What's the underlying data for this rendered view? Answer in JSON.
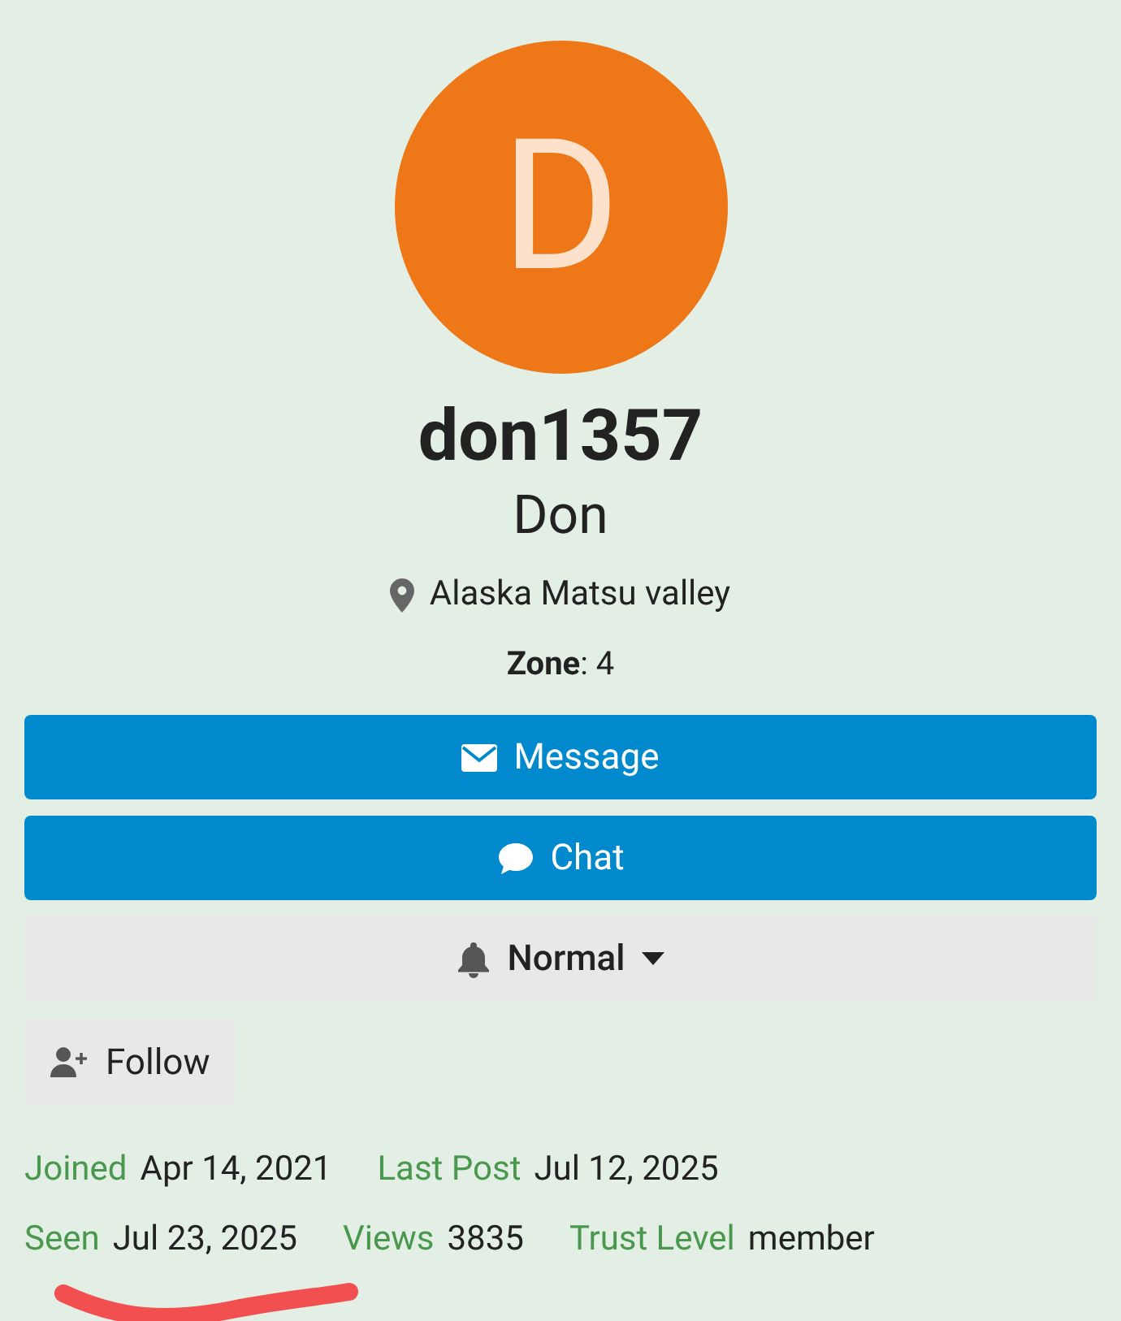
{
  "profile": {
    "avatar_letter": "D",
    "username": "don1357",
    "name": "Don",
    "location": "Alaska Matsu valley",
    "zone": "**Zone**: 4"
  },
  "actions": [
    {
      "kind": "primary",
      "label": "Message"
    },
    {
      "kind": "primary",
      "label": "Chat"
    },
    {
      "kind": "dropdown",
      "label": "Normal"
    }
  ],
  "follow": {
    "label": "Follow"
  },
  "stats": [
    [
      {
        "label": "Joined",
        "value": "Apr 14, 2021"
      },
      {
        "label": "Last Post",
        "value": "Jul 12, 2025"
      }
    ],
    [
      {
        "label": "Seen",
        "value": "Jul 23, 2025"
      },
      {
        "label": "Views",
        "value": "3835"
      },
      {
        "label": "Trust Level",
        "value": "member"
      }
    ]
  ],
  "annotation": {
    "kind": "underline"
  }
}
